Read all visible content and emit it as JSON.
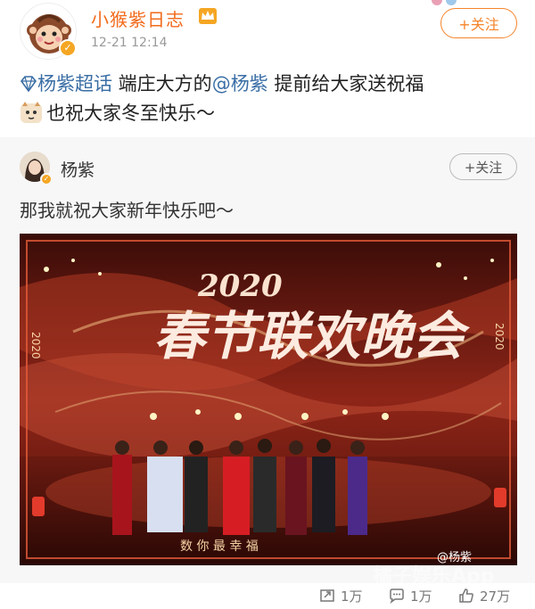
{
  "post": {
    "username": "小猴紫日志",
    "time": "12-21 12:14",
    "follow_label": "+关注",
    "text": {
      "topic": "杨紫超话",
      "before_mention": " 端庄大方的",
      "mention": "@杨紫",
      "after_mention": " 提前给大家送祝福",
      "line2": "也祝大家冬至快乐～"
    }
  },
  "repost": {
    "username": "杨紫",
    "follow_label": "+关注",
    "text": "那我就祝大家新年快乐吧～",
    "image": {
      "stage_title": "春节联欢晚会",
      "year_logo": "2020",
      "stage_caption": "数 你 最 幸 福",
      "side_year": "2020"
    },
    "watermark_user": "@杨紫",
    "watermark_app": "橘子娱乐App"
  },
  "actions": {
    "repost_count": "1万",
    "comment_count": "1万",
    "like_count": "27万"
  },
  "colors": {
    "username": "#f26a1b",
    "follow": "#f5842b",
    "link": "#3a6ea5"
  }
}
